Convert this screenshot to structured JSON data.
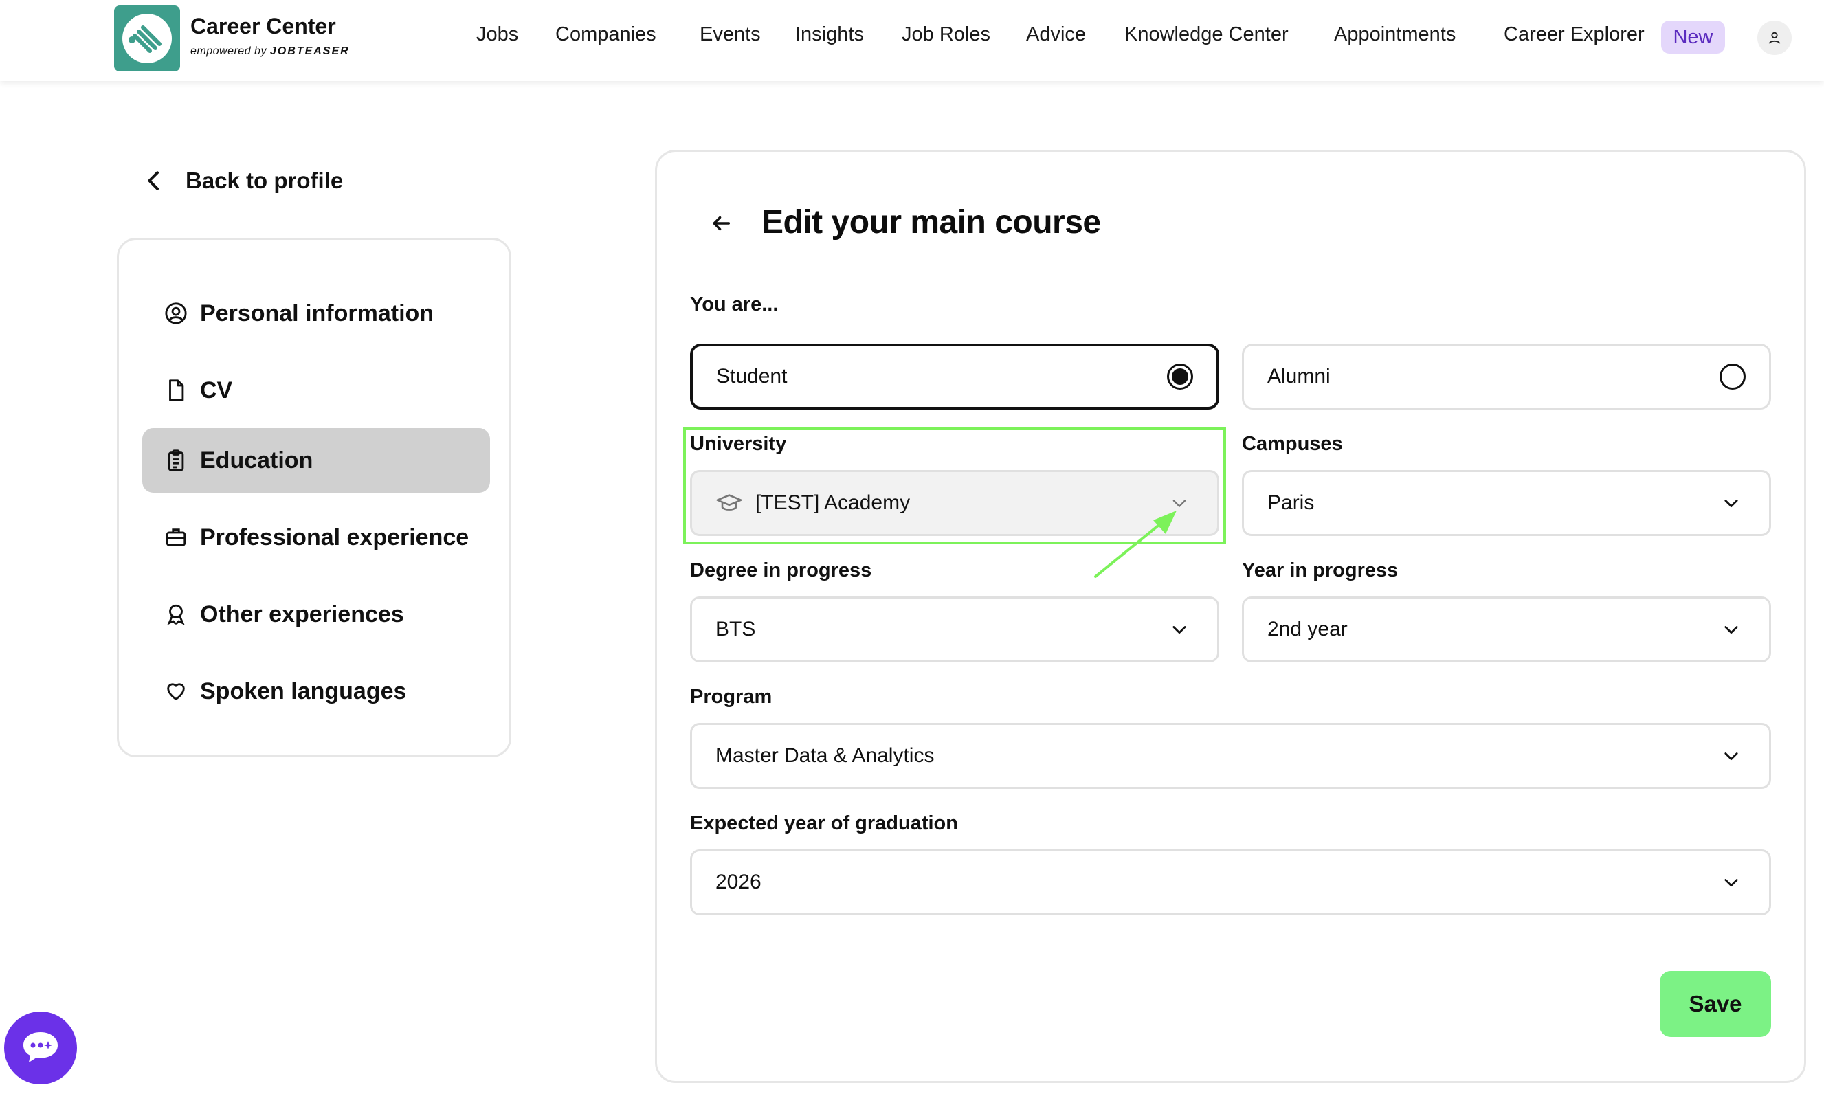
{
  "header": {
    "brand_title": "Career Center",
    "brand_sub_prefix": "empowered by ",
    "brand_sub_name": "JOBTEASER",
    "nav": [
      {
        "label": "Jobs"
      },
      {
        "label": "Companies"
      },
      {
        "label": "Events"
      },
      {
        "label": "Insights"
      },
      {
        "label": "Job Roles"
      },
      {
        "label": "Advice"
      },
      {
        "label": "Knowledge Center"
      },
      {
        "label": "Appointments"
      },
      {
        "label": "Career Explorer"
      }
    ],
    "new_badge": "New",
    "logo_color": "#3e9e8c"
  },
  "sidebar": {
    "back_label": "Back to profile",
    "items": [
      {
        "label": "Personal information",
        "icon": "user-circle-icon"
      },
      {
        "label": "CV",
        "icon": "file-icon"
      },
      {
        "label": "Education",
        "icon": "clipboard-icon",
        "active": true
      },
      {
        "label": "Professional experience",
        "icon": "briefcase-icon"
      },
      {
        "label": "Other experiences",
        "icon": "award-icon"
      },
      {
        "label": "Spoken languages",
        "icon": "heart-icon"
      }
    ]
  },
  "form": {
    "title": "Edit your main course",
    "you_are_label": "You are...",
    "status_options": [
      {
        "label": "Student",
        "selected": true
      },
      {
        "label": "Alumni",
        "selected": false
      }
    ],
    "university": {
      "label": "University",
      "value": "[TEST] Academy"
    },
    "campuses": {
      "label": "Campuses",
      "value": "Paris"
    },
    "degree": {
      "label": "Degree in progress",
      "value": "BTS"
    },
    "year": {
      "label": "Year in progress",
      "value": "2nd year"
    },
    "program": {
      "label": "Program",
      "value": "Master Data & Analytics"
    },
    "graduation": {
      "label": "Expected year of graduation",
      "value": "2026"
    },
    "save_label": "Save"
  },
  "colors": {
    "accent_green": "#7cf285",
    "highlight_green": "#7cf25a",
    "badge_bg": "#e4d7fb",
    "badge_text": "#5b2bbf",
    "chat_purple": "#6b31e8",
    "active_item_bg": "#d0d0d0"
  }
}
